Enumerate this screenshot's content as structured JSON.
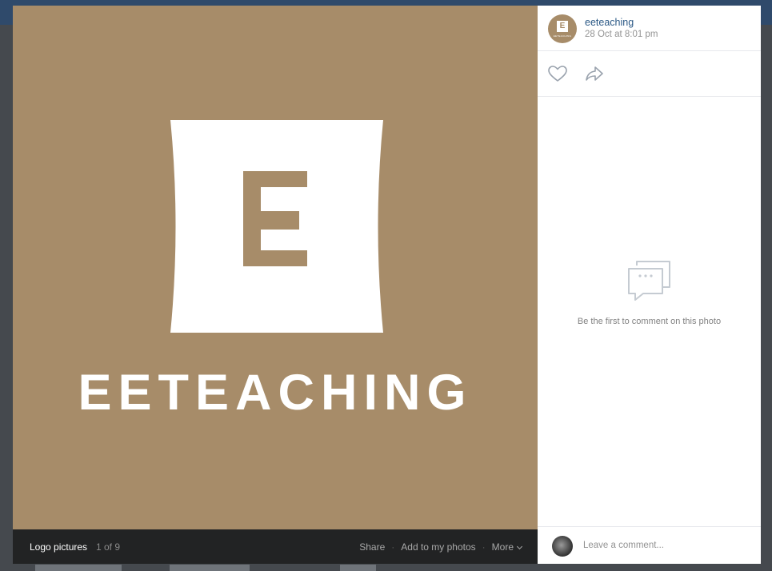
{
  "photo": {
    "logo_letter": "E",
    "logo_word": "EETEACHING",
    "colors": {
      "logo_background": "#a78c69",
      "logo_foreground": "#ffffff"
    }
  },
  "photo_bar": {
    "album_name": "Logo pictures",
    "counter": "1 of 9",
    "actions": {
      "share": "Share",
      "add": "Add to my photos",
      "more": "More"
    },
    "separator": "·"
  },
  "post": {
    "author": "eeteaching",
    "date": "28 Oct at 8:01 pm",
    "avatar_letter": "E",
    "avatar_wordmark": "EETEACHING"
  },
  "icons": {
    "like": "heart-icon",
    "share": "share-arrow-icon",
    "empty": "speech-bubbles-icon",
    "more": "chevron-down-icon"
  },
  "comments": {
    "empty_text": "Be the first to comment on this photo",
    "placeholder": "Leave a comment..."
  },
  "colors": {
    "link": "#2a5885",
    "muted": "#939393",
    "bar_background": "#222324"
  }
}
